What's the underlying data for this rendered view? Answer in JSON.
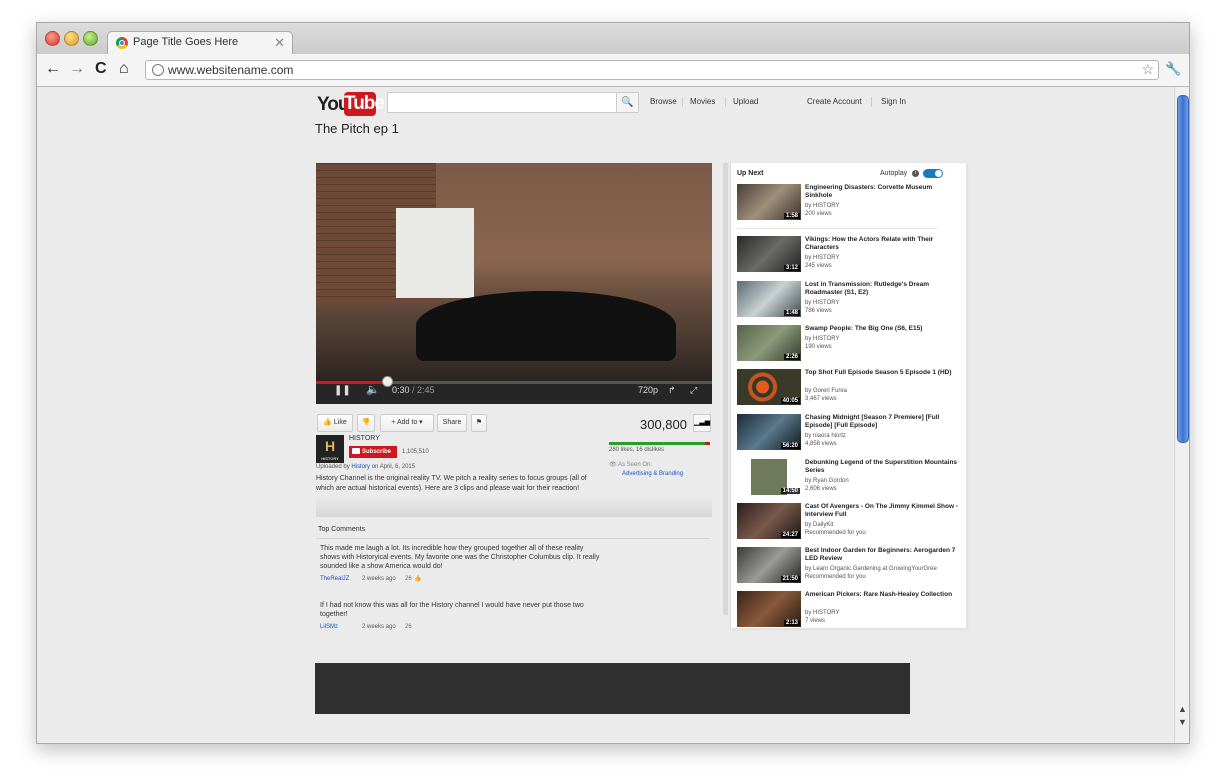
{
  "browser": {
    "tab_title": "Page Title Goes Here",
    "url": "www.websitename.com"
  },
  "header": {
    "logo_you": "You",
    "logo_tube": "Tube",
    "nav": [
      "Browse",
      "Movies",
      "Upload"
    ],
    "create_account": "Create Account",
    "sign_in": "Sign In"
  },
  "video": {
    "title": "The Pitch ep 1",
    "time_current": "0:30",
    "time_total": "/ 2:45",
    "progress_fraction": 0.18,
    "quality": "720p",
    "view_count": "300,800",
    "likes_text": "280 likes, 16 dislikes",
    "like_fraction": 0.95,
    "as_seen_on": "As Seen On:",
    "as_seen_link": "Advertising & Branding"
  },
  "actions": {
    "like": "Like",
    "add_to": "Add to",
    "share": "Share"
  },
  "channel": {
    "name": "HISTORY",
    "logo_letter": "H",
    "logo_text": "HISTORY",
    "subscribe": "Subscribe",
    "subscribers": "1,105,510",
    "uploaded_prefix": "Uploaded by",
    "uploaded_by": "History",
    "uploaded_date": "on April, 6, 2015",
    "description": "History Channel is the original reality TV. We pitch a reality series to focus groups (all of which are actual historical events). Here are 3 clips and please wait for their reaction!"
  },
  "comments": {
    "heading": "Top Comments",
    "items": [
      {
        "text": "This made me laugh a lot. Its incredible how they grouped together all of these reality shows with Historyical events. My favorite one was the Christopher Columbus clip. It really sounded like a show America would do!",
        "user": "TheRealJZ",
        "time": "2 weeks ago",
        "likes": "26"
      },
      {
        "text": "If I had not know this was all for the History channel I would have never put those two together!",
        "user": "LilSMz",
        "time": "2 weeks ago",
        "likes": "26"
      }
    ]
  },
  "upnext": {
    "title": "Up Next",
    "autoplay": "Autoplay",
    "info": "i",
    "items": [
      {
        "title": "Engineering Disasters: Corvette Museum Sinkhole",
        "channel": "by HISTORY",
        "views": "200 views",
        "duration": "1:58"
      },
      {
        "title": "Vikings: How the Actors Relate with Their Characters",
        "channel": "by HISTORY",
        "views": "245 views",
        "duration": "3:12"
      },
      {
        "title": "Lost in Transmission: Rutledge's Dream Roadmaster (S1, E2)",
        "channel": "by HISTORY",
        "views": "786 views",
        "duration": "1:48"
      },
      {
        "title": "Swamp People: The Big One (S6, E15)",
        "channel": "by HISTORY",
        "views": "190 views",
        "duration": "2:26"
      },
      {
        "title": "Top Shot Full Episode Season 5 Episode 1 (HD)",
        "channel": "by Goreri Furea",
        "views": "3,467 views",
        "duration": "40:05"
      },
      {
        "title": "Chasing Midnight [Season 7 Premiere] [Full Episode] [Full Episode]",
        "channel": "by niaora hiorlz",
        "views": "4,858 views",
        "duration": "56:20"
      },
      {
        "title": "Debunking Legend of the Superstition Mountains Series",
        "channel": "by Ryan Gordon",
        "views": "2,606 views",
        "duration": "14:50"
      },
      {
        "title": "Cast Of Avengers - On The Jimmy Kimmel Show - Interview Full",
        "channel": "by DailyKit",
        "views": "Recommended for you",
        "duration": "24:27"
      },
      {
        "title": "Best Indoor Garden for Beginners: Aerogarden 7 LED Review",
        "channel": "by Learn Organic Gardening at GrowingYourGree",
        "views": "Recommended for you",
        "duration": "21:50"
      },
      {
        "title": "American Pickers: Rare Nash-Healey Collection",
        "channel": "by HISTORY",
        "views": "7 views",
        "duration": "2:13"
      }
    ]
  },
  "colors": {
    "brand_red": "#cc181e",
    "link_blue": "#1a52c6",
    "like_green": "#2b9b2b"
  }
}
